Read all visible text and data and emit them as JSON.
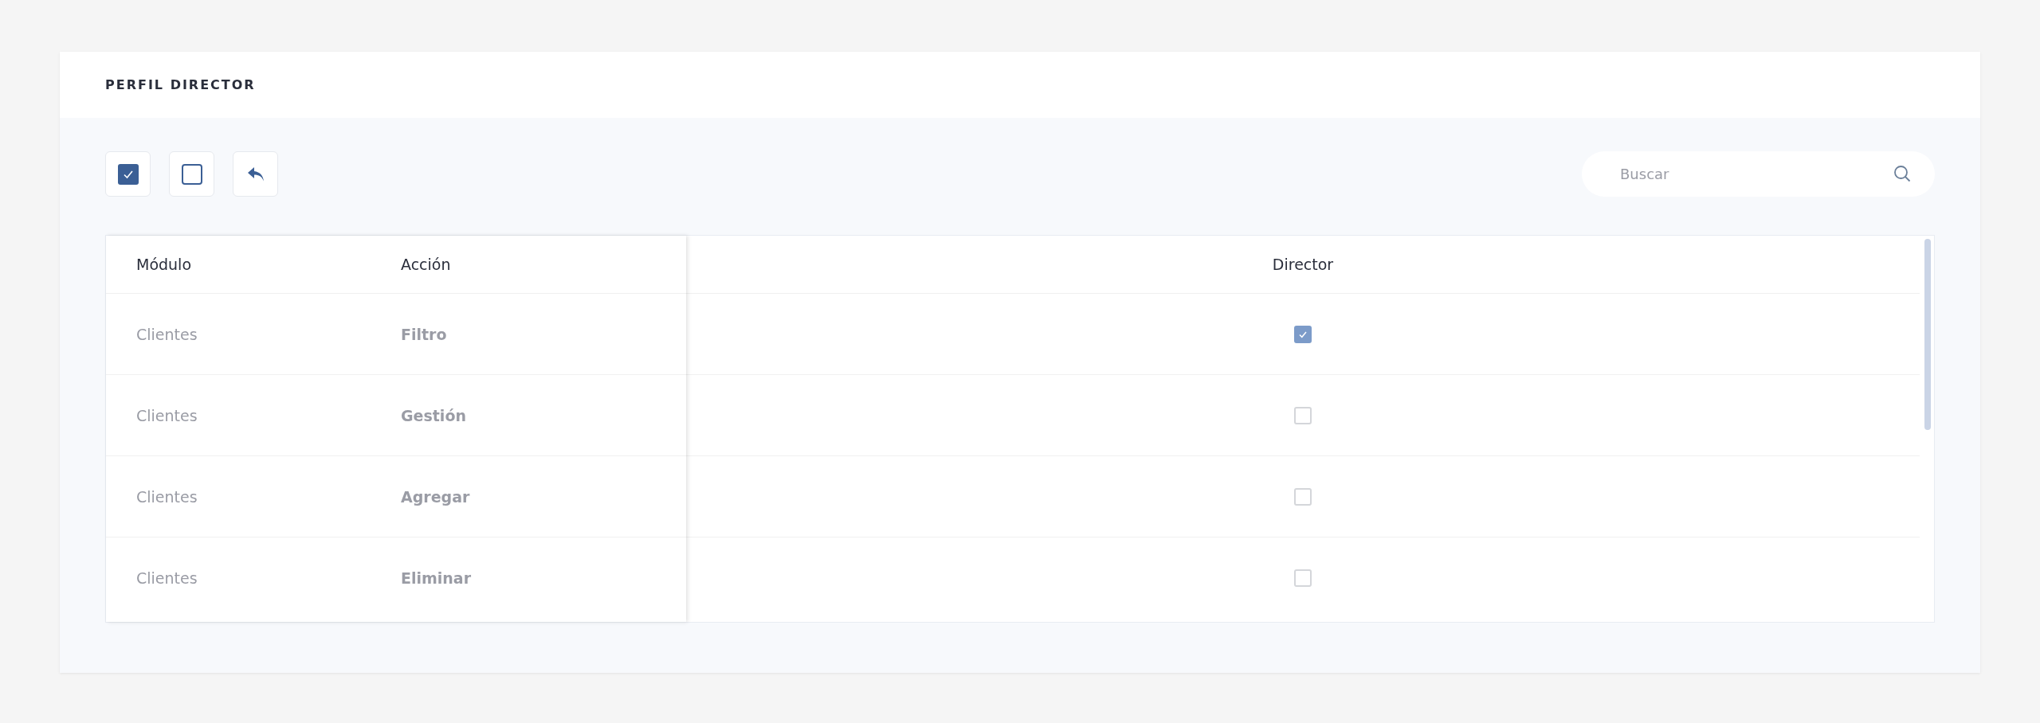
{
  "panel": {
    "title": "PERFIL DIRECTOR"
  },
  "search": {
    "placeholder": "Buscar"
  },
  "table": {
    "columns": [
      "Módulo",
      "Acción",
      "Director"
    ],
    "rows": [
      {
        "module": "Clientes",
        "action": "Filtro",
        "checked": true
      },
      {
        "module": "Clientes",
        "action": "Gestión",
        "checked": false
      },
      {
        "module": "Clientes",
        "action": "Agregar",
        "checked": false
      },
      {
        "module": "Clientes",
        "action": "Eliminar",
        "checked": false
      }
    ]
  }
}
